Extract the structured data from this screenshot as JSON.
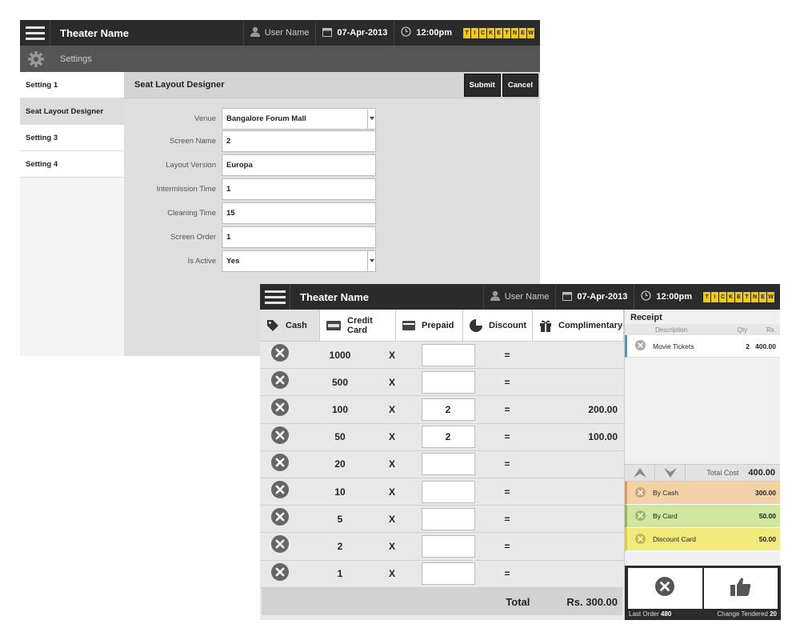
{
  "settings_window": {
    "header": {
      "title": "Theater Name",
      "user": "User Name",
      "date": "07-Apr-2013",
      "time": "12:00pm",
      "logo_letters": [
        "T",
        "I",
        "C",
        "K",
        "E",
        "T",
        "N",
        "E",
        "W"
      ]
    },
    "subbar_label": "Settings",
    "sidebar": [
      {
        "label": "Setting 1",
        "active": false
      },
      {
        "label": "Seat Layout Designer",
        "active": true
      },
      {
        "label": "Setting 3",
        "active": false
      },
      {
        "label": "Setting 4",
        "active": false
      }
    ],
    "content_title": "Seat Layout Designer",
    "submit_label": "Submit",
    "cancel_label": "Cancel",
    "form": [
      {
        "label": "Venue",
        "value": "Bangalore Forum Mall",
        "type": "select"
      },
      {
        "label": "Screen Name",
        "value": "2",
        "type": "text"
      },
      {
        "label": "Layout Version",
        "value": "Europa",
        "type": "text"
      },
      {
        "label": "Intermission Time",
        "value": "1",
        "type": "text"
      },
      {
        "label": "Cleaning Time",
        "value": "15",
        "type": "text"
      },
      {
        "label": "Screen Order",
        "value": "1",
        "type": "text"
      },
      {
        "label": "Is Active",
        "value": "Yes",
        "type": "select"
      }
    ]
  },
  "pos_window": {
    "header": {
      "title": "Theater Name",
      "user": "User Name",
      "date": "07-Apr-2013",
      "time": "12:00pm"
    },
    "tabs": [
      {
        "label": "Cash",
        "icon": "tag-icon",
        "active": true
      },
      {
        "label": "Credit Card",
        "icon": "visa-card-icon",
        "active": false
      },
      {
        "label": "Prepaid",
        "icon": "wallet-icon",
        "active": false
      },
      {
        "label": "Discount",
        "icon": "pie-icon",
        "active": false
      },
      {
        "label": "Complimentary",
        "icon": "gift-icon",
        "active": false
      }
    ],
    "denominations": [
      {
        "value": "1000",
        "qty": "",
        "amount": ""
      },
      {
        "value": "500",
        "qty": "",
        "amount": ""
      },
      {
        "value": "100",
        "qty": "2",
        "amount": "200.00"
      },
      {
        "value": "50",
        "qty": "2",
        "amount": "100.00"
      },
      {
        "value": "20",
        "qty": "",
        "amount": ""
      },
      {
        "value": "10",
        "qty": "",
        "amount": ""
      },
      {
        "value": "5",
        "qty": "",
        "amount": ""
      },
      {
        "value": "2",
        "qty": "",
        "amount": ""
      },
      {
        "value": "1",
        "qty": "",
        "amount": ""
      }
    ],
    "multiply_sign": "X",
    "equals_sign": "=",
    "total_label": "Total",
    "total_value": "Rs. 300.00",
    "receipt": {
      "title": "Receipt",
      "col_description": "Description",
      "col_qty": "Qty",
      "col_rs": "Rs.",
      "items": [
        {
          "description": "Movie Tickets",
          "qty": "2",
          "amount": "400.00"
        }
      ],
      "total_cost_label": "Total Cost",
      "total_cost_value": "400.00",
      "payments": [
        {
          "label": "By Cash",
          "amount": "300.00",
          "kind": "cash"
        },
        {
          "label": "By Card",
          "amount": "50.00",
          "kind": "card"
        },
        {
          "label": "Discount Card",
          "amount": "50.00",
          "kind": "disc"
        }
      ],
      "last_order_label": "Last Order",
      "last_order_value": "480",
      "change_tendered_label": "Change Tendered",
      "change_tendered_value": "20"
    }
  },
  "colors": {
    "header_bg": "#2b2b2b",
    "logo_yellow": "#f5c800",
    "cash_accent": "#e89a46",
    "card_accent": "#8cbf3a",
    "discount_accent": "#e0cf2a",
    "receipt_item_accent": "#2aa8c8"
  }
}
